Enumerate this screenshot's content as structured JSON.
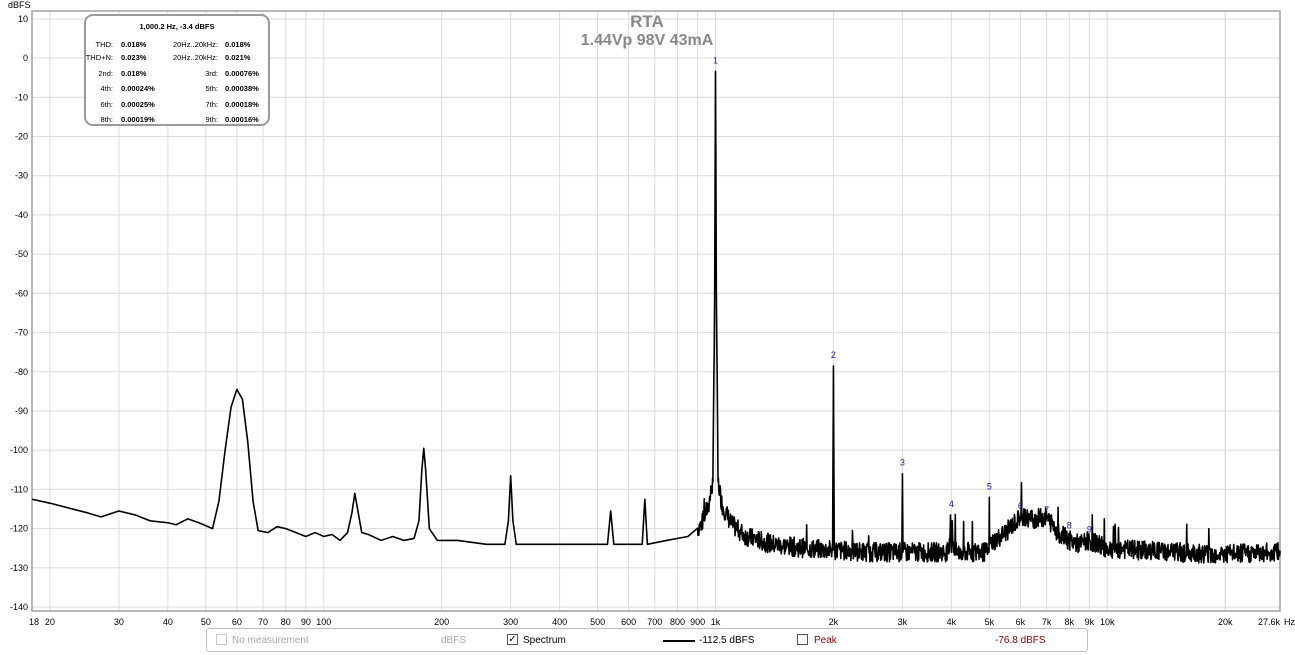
{
  "chart_data": {
    "type": "line",
    "title": "RTA",
    "subtitle": "1.44Vp 98V 43mA",
    "ylabel": "dBFS",
    "xlabel": "",
    "x_unit_label": "Hz",
    "x_scale": "log",
    "xlim": [
      18,
      27600
    ],
    "ylim": [
      -141,
      12
    ],
    "grid": true,
    "y_ticks": [
      "10",
      "0",
      "-10",
      "-20",
      "-30",
      "-40",
      "-50",
      "-60",
      "-70",
      "-80",
      "-90",
      "-100",
      "-110",
      "-120",
      "-130",
      "-140"
    ],
    "x_ticks": [
      {
        "label": "18",
        "value": 18
      },
      {
        "label": "20",
        "value": 20
      },
      {
        "label": "30",
        "value": 30
      },
      {
        "label": "40",
        "value": 40
      },
      {
        "label": "50",
        "value": 50
      },
      {
        "label": "60",
        "value": 60
      },
      {
        "label": "70",
        "value": 70
      },
      {
        "label": "80",
        "value": 80
      },
      {
        "label": "90",
        "value": 90
      },
      {
        "label": "100",
        "value": 100
      },
      {
        "label": "200",
        "value": 200
      },
      {
        "label": "300",
        "value": 300
      },
      {
        "label": "400",
        "value": 400
      },
      {
        "label": "500",
        "value": 500
      },
      {
        "label": "600",
        "value": 600
      },
      {
        "label": "700",
        "value": 700
      },
      {
        "label": "800",
        "value": 800
      },
      {
        "label": "900",
        "value": 900
      },
      {
        "label": "1k",
        "value": 1000
      },
      {
        "label": "2k",
        "value": 2000
      },
      {
        "label": "3k",
        "value": 3000
      },
      {
        "label": "4k",
        "value": 4000
      },
      {
        "label": "5k",
        "value": 5000
      },
      {
        "label": "6k",
        "value": 6000
      },
      {
        "label": "7k",
        "value": 7000
      },
      {
        "label": "8k",
        "value": 8000
      },
      {
        "label": "9k",
        "value": 9000
      },
      {
        "label": "10k",
        "value": 10000
      },
      {
        "label": "20k",
        "value": 20000
      },
      {
        "label": "27.6k",
        "value": 27600
      }
    ],
    "series": [
      {
        "name": "Spectrum",
        "color": "#000000",
        "baseline": [
          [
            18,
            -112.5
          ],
          [
            20,
            -113.5
          ],
          [
            25,
            -116
          ],
          [
            27,
            -117
          ],
          [
            30,
            -115.5
          ],
          [
            33,
            -116.5
          ],
          [
            36,
            -118
          ],
          [
            40,
            -118.5
          ],
          [
            42,
            -119
          ],
          [
            45,
            -117.5
          ],
          [
            48,
            -118.5
          ],
          [
            52,
            -120
          ],
          [
            54,
            -113
          ],
          [
            56,
            -100
          ],
          [
            58,
            -89
          ],
          [
            60,
            -84.5
          ],
          [
            62,
            -87
          ],
          [
            64,
            -98
          ],
          [
            66,
            -113
          ],
          [
            68,
            -120.5
          ],
          [
            72,
            -121
          ],
          [
            76,
            -119.5
          ],
          [
            80,
            -120
          ],
          [
            85,
            -121
          ],
          [
            90,
            -122
          ],
          [
            95,
            -121
          ],
          [
            100,
            -122
          ],
          [
            105,
            -121.5
          ],
          [
            110,
            -123
          ],
          [
            115,
            -121
          ],
          [
            118,
            -116
          ],
          [
            120,
            -111
          ],
          [
            122,
            -115
          ],
          [
            125,
            -121
          ],
          [
            130,
            -121.5
          ],
          [
            140,
            -123
          ],
          [
            150,
            -122
          ],
          [
            160,
            -123
          ],
          [
            170,
            -122.5
          ],
          [
            175,
            -118
          ],
          [
            178,
            -105
          ],
          [
            180,
            -99.5
          ],
          [
            182,
            -105
          ],
          [
            186,
            -120
          ],
          [
            195,
            -123
          ],
          [
            220,
            -123
          ],
          [
            260,
            -124
          ],
          [
            290,
            -124
          ],
          [
            296,
            -118
          ],
          [
            300,
            -106.5
          ],
          [
            304,
            -118
          ],
          [
            310,
            -124
          ],
          [
            400,
            -124
          ],
          [
            530,
            -124
          ],
          [
            540,
            -115.5
          ],
          [
            550,
            -124
          ],
          [
            650,
            -124
          ],
          [
            660,
            -112.5
          ],
          [
            670,
            -124
          ],
          [
            750,
            -123
          ],
          [
            850,
            -122
          ],
          [
            920,
            -119
          ],
          [
            960,
            -114
          ],
          [
            985,
            -108
          ],
          [
            995,
            -60
          ],
          [
            1000,
            -3.4
          ],
          [
            1005,
            -60
          ],
          [
            1015,
            -108
          ],
          [
            1040,
            -114
          ],
          [
            1100,
            -119
          ],
          [
            1200,
            -122
          ],
          [
            1400,
            -124
          ],
          [
            1700,
            -125
          ],
          [
            1990,
            -125.5
          ],
          [
            2000,
            -78.5
          ],
          [
            2010,
            -125.5
          ],
          [
            2500,
            -126
          ],
          [
            2990,
            -126
          ],
          [
            3000,
            -106
          ],
          [
            3010,
            -126
          ],
          [
            3950,
            -126
          ],
          [
            3980,
            -116.5
          ],
          [
            4000,
            -126
          ],
          [
            4020,
            -118
          ],
          [
            4050,
            -126
          ],
          [
            4990,
            -126
          ],
          [
            5000,
            -112
          ],
          [
            5010,
            -124
          ],
          [
            5500,
            -121
          ],
          [
            6000,
            -117
          ],
          [
            6500,
            -117.5
          ],
          [
            7000,
            -117
          ],
          [
            7500,
            -121
          ],
          [
            8000,
            -123
          ],
          [
            8500,
            -124
          ],
          [
            9000,
            -123
          ],
          [
            10000,
            -125
          ],
          [
            15000,
            -126
          ],
          [
            20000,
            -126.5
          ],
          [
            27600,
            -126
          ]
        ],
        "noise_from_hz": 900
      }
    ],
    "harmonic_markers": [
      {
        "label": "1",
        "x": 1000,
        "y": -3.4
      },
      {
        "label": "2",
        "x": 2000,
        "y": -78.5
      },
      {
        "label": "3",
        "x": 3000,
        "y": -106
      },
      {
        "label": "4",
        "x": 4000,
        "y": -116.5
      },
      {
        "label": "5",
        "x": 5000,
        "y": -112
      },
      {
        "label": "6",
        "x": 6000,
        "y": -117
      },
      {
        "label": "7",
        "x": 7000,
        "y": -118
      },
      {
        "label": "8",
        "x": 8000,
        "y": -122
      },
      {
        "label": "9",
        "x": 9000,
        "y": -123
      }
    ]
  },
  "distortion_box": {
    "heading": "1,000.2 Hz, -3.4 dBFS",
    "rows": [
      {
        "l1": "THD:",
        "v1": "0.018%",
        "l2": "20Hz..20kHz:",
        "v2": "0.018%"
      },
      {
        "l1": "THD+N:",
        "v1": "0.023%",
        "l2": "20Hz..20kHz:",
        "v2": "0.021%"
      },
      {
        "l1": "2nd:",
        "v1": "0.018%",
        "l2": "3rd:",
        "v2": "0.00076%"
      },
      {
        "l1": "4th:",
        "v1": "0.00024%",
        "l2": "5th:",
        "v2": "0.00038%"
      },
      {
        "l1": "6th:",
        "v1": "0.00025%",
        "l2": "7th:",
        "v2": "0.00018%"
      },
      {
        "l1": "8th:",
        "v1": "0.00019%",
        "l2": "9th:",
        "v2": "0.00016%"
      }
    ]
  },
  "legend": {
    "no_measurement": {
      "label": "No measurement",
      "unit": "dBFS",
      "checked": false
    },
    "spectrum": {
      "label": "Spectrum",
      "value": "-112.5 dBFS",
      "checked": true,
      "check_glyph": "✓"
    },
    "peak": {
      "label": "Peak",
      "value": "-76.8 dBFS",
      "checked": false,
      "color": "#8b0000"
    }
  }
}
